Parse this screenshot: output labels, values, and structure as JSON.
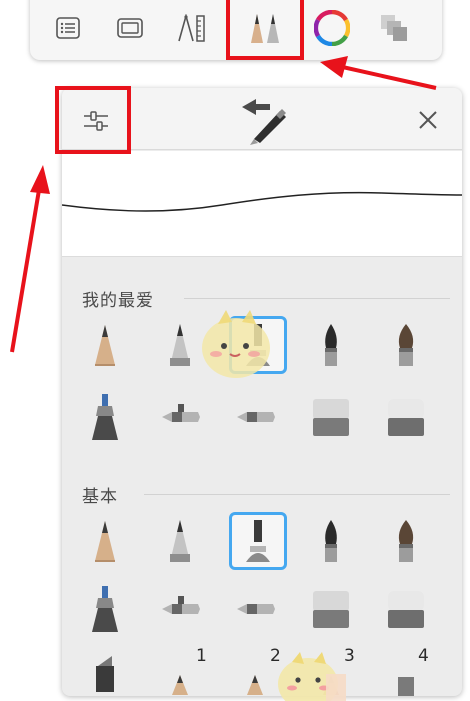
{
  "toolbar": {
    "buttons": [
      {
        "name": "list-icon"
      },
      {
        "name": "canvas-frame-icon"
      },
      {
        "name": "ruler-compass-icon"
      },
      {
        "name": "brushes-icon",
        "selected": true
      },
      {
        "name": "color-wheel-icon"
      },
      {
        "name": "layers-copy-icon"
      }
    ],
    "selected_color": "#e8121b"
  },
  "panel": {
    "settings_icon": "sliders-icon",
    "swap_icon": "swap-brush-icon",
    "close_icon": "close-icon",
    "favorites_title": "我的最爱",
    "basic_title": "基本",
    "selection_color": "#45a8f0",
    "size_labels": [
      "1",
      "2",
      "3",
      "4"
    ]
  },
  "annotations": {
    "highlight_color": "#e8121b",
    "arrow_color": "#e8121b"
  }
}
